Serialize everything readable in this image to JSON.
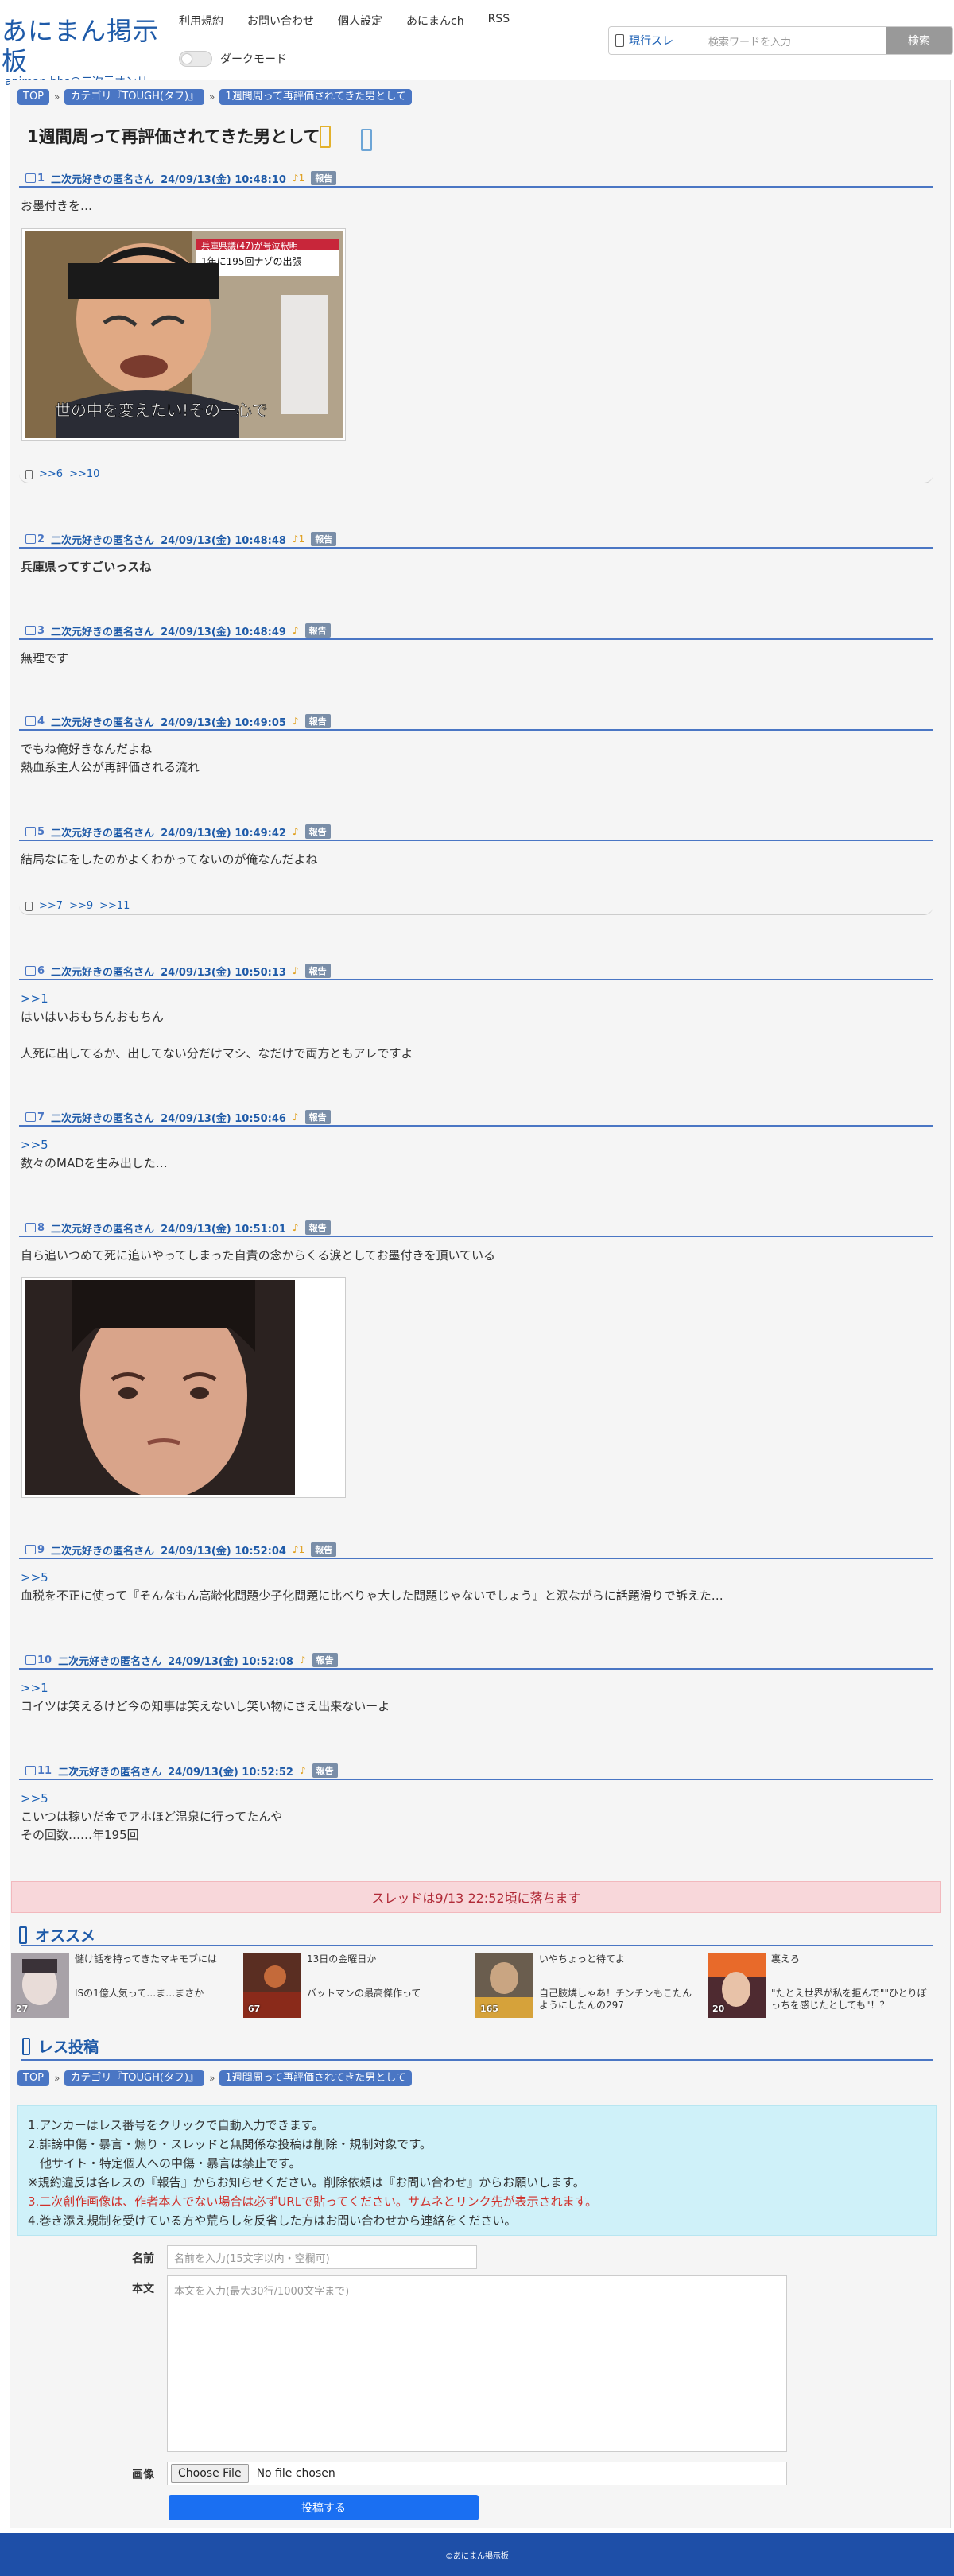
{
  "header": {
    "logo_title": "あにまん掲示板",
    "logo_sub": "animan bbs@二次元オンリー",
    "nav": [
      "利用規約",
      "お問い合わせ",
      "個人設定",
      "あにまんch",
      "RSS"
    ],
    "darkmode_label": "ダークモード",
    "search_scope": "現行スレ",
    "search_placeholder": "検索ワードを入力",
    "search_button": "検索"
  },
  "breadcrumb": [
    "TOP",
    "カテゴリ『TOUGH(タフ)』",
    "1週間周って再評価されてきた男として"
  ],
  "thread_title": "1週間周って再評価されてきた男として",
  "posts": [
    {
      "num": "1",
      "name": "二次元好きの匿名さん",
      "date": "24/09/13(金) 10:48:10",
      "good": "1",
      "report": "報告",
      "body": [
        "お墨付きを…"
      ],
      "replies": [
        ">>6",
        ">>10"
      ]
    },
    {
      "num": "2",
      "name": "二次元好きの匿名さん",
      "date": "24/09/13(金) 10:48:48",
      "good": "1",
      "report": "報告",
      "body": [
        "兵庫県ってすごいっスね"
      ]
    },
    {
      "num": "3",
      "name": "二次元好きの匿名さん",
      "date": "24/09/13(金) 10:48:49",
      "good": "",
      "report": "報告",
      "body": [
        "無理です"
      ]
    },
    {
      "num": "4",
      "name": "二次元好きの匿名さん",
      "date": "24/09/13(金) 10:49:05",
      "good": "",
      "report": "報告",
      "body": [
        "でもね俺好きなんだよね",
        "熱血系主人公が再評価される流れ"
      ]
    },
    {
      "num": "5",
      "name": "二次元好きの匿名さん",
      "date": "24/09/13(金) 10:49:42",
      "good": "",
      "report": "報告",
      "body": [
        "結局なにをしたのかよくわかってないのが俺なんだよね"
      ],
      "replies": [
        ">>7",
        ">>9",
        ">>11"
      ]
    },
    {
      "num": "6",
      "name": "二次元好きの匿名さん",
      "date": "24/09/13(金) 10:50:13",
      "good": "",
      "report": "報告",
      "anchor": ">>1",
      "body": [
        "はいはいおもちんおもちん",
        "",
        "人死に出してるか、出してない分だけマシ、なだけで両方ともアレですよ"
      ]
    },
    {
      "num": "7",
      "name": "二次元好きの匿名さん",
      "date": "24/09/13(金) 10:50:46",
      "good": "",
      "report": "報告",
      "anchor": ">>5",
      "body": [
        "数々のMADを生み出した…"
      ]
    },
    {
      "num": "8",
      "name": "二次元好きの匿名さん",
      "date": "24/09/13(金) 10:51:01",
      "good": "",
      "report": "報告",
      "body": [
        "自ら追いつめて死に追いやってしまった自責の念からくる涙としてお墨付きを頂いている"
      ]
    },
    {
      "num": "9",
      "name": "二次元好きの匿名さん",
      "date": "24/09/13(金) 10:52:04",
      "good": "1",
      "report": "報告",
      "anchor": ">>5",
      "body": [
        "血税を不正に使って『そんなもん高齢化問題少子化問題に比べりゃ大した問題じゃないでしょう』と涙ながらに話題滑りで訴えた…"
      ]
    },
    {
      "num": "10",
      "name": "二次元好きの匿名さん",
      "date": "24/09/13(金) 10:52:08",
      "good": "",
      "report": "報告",
      "anchor": ">>1",
      "body": [
        "コイツは笑えるけど今の知事は笑えないし笑い物にさえ出来ないーよ"
      ]
    },
    {
      "num": "11",
      "name": "二次元好きの匿名さん",
      "date": "24/09/13(金) 10:52:52",
      "good": "",
      "report": "報告",
      "anchor": ">>5",
      "body": [
        "こいつは稼いだ金でアホほど温泉に行ってたんや",
        "その回数……年195回"
      ]
    }
  ],
  "image1_caption": "世の中を変えたい!その一心で",
  "image1_ticker": "兵庫県議(47)が号泣釈明 1年に195回ナゾの出張",
  "ended_notice": "スレッドは9/13 22:52頃に落ちます",
  "recommended": {
    "title": "オススメ",
    "items": [
      {
        "title": "儲け話を持ってきたマキモブには",
        "desc": "ISの1億人気って…ま…まさか",
        "count": "27",
        "thumb_color": "#a8a2a8"
      },
      {
        "title": "13日の金曜日か",
        "desc": "バットマンの最高傑作って",
        "count": "67",
        "thumb_color": "#5a2e22"
      },
      {
        "title": "いやちょっと待てよ",
        "desc": "自己肢燐しゃあ！チンチンもこたんようにしたんの297",
        "count": "165",
        "thumb_color": "#6a5d4e"
      },
      {
        "title": "裏えろ",
        "desc": "\"たとえ世界が私を拒んで\"\"ひとりぼっちを感じたとしても\"！？",
        "count": "20",
        "thumb_color": "#4e2a30"
      }
    ]
  },
  "reply_section": {
    "title": "レス投稿",
    "rules": [
      "1.アンカーはレス番号をクリックで自動入力できます。",
      "2.誹謗中傷・暴言・煽り・スレッドと無関係な投稿は削除・規制対象です。",
      "　他サイト・特定個人への中傷・暴言は禁止です。",
      "※規約違反は各レスの『報告』からお知らせください。削除依頼は『お問い合わせ』からお願いします。",
      "3.二次創作画像は、作者本人でない場合は必ずURLで貼ってください。サムネとリンク先が表示されます。",
      "4.巻き添え規制を受けている方や荒らしを反省した方はお問い合わせから連絡をください。"
    ],
    "name_label": "名前",
    "name_placeholder": "名前を入力(15文字以内・空欄可)",
    "body_label": "本文",
    "body_placeholder": "本文を入力(最大30行/1000文字まで)",
    "image_label": "画像",
    "file_button": "Choose File",
    "file_status": "No file chosen",
    "submit": "投稿する"
  },
  "footer": "©あにまん掲示板"
}
